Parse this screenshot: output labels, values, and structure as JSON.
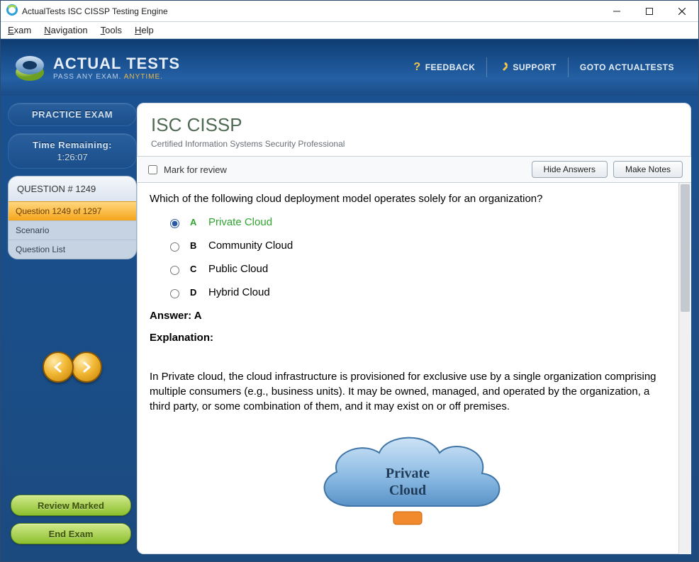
{
  "window": {
    "title": "ActualTests ISC CISSP Testing Engine"
  },
  "menu": {
    "exam": "Exam",
    "navigation": "Navigation",
    "tools": "Tools",
    "help": "Help"
  },
  "brand": {
    "name": "ACTUAL TESTS",
    "tag_pass": "PASS ANY EXAM.",
    "tag_any": "ANYTIME."
  },
  "topLinks": {
    "feedback": "FEEDBACK",
    "support": "SUPPORT",
    "goto": "GOTO ACTUALTESTS"
  },
  "sidebar": {
    "practice": "PRACTICE EXAM",
    "timeLabel": "Time Remaining:",
    "timeValue": "1:26:07",
    "questionHash": "QUESTION # 1249",
    "progress": "Question 1249 of 1297",
    "scenario": "Scenario",
    "questionList": "Question List",
    "reviewMarked": "Review Marked",
    "endExam": "End Exam"
  },
  "main": {
    "title": "ISC CISSP",
    "subtitle": "Certified Information Systems Security Professional",
    "mark": "Mark for review",
    "hideAnswers": "Hide Answers",
    "makeNotes": "Make Notes",
    "question": "Which of the following cloud deployment model operates solely for an organization?",
    "options": {
      "A": "Private Cloud",
      "B": "Community Cloud",
      "C": "Public Cloud",
      "D": "Hybrid Cloud"
    },
    "answer": "Answer: A",
    "explanationLabel": "Explanation:",
    "explanation": "In Private cloud, the cloud infrastructure is provisioned for exclusive use by a single organization comprising multiple consumers (e.g., business units). It may be owned, managed, and operated by the organization, a third party, or some combination of them, and it may exist on or off premises.",
    "cloudLabel1": "Private",
    "cloudLabel2": "Cloud"
  }
}
